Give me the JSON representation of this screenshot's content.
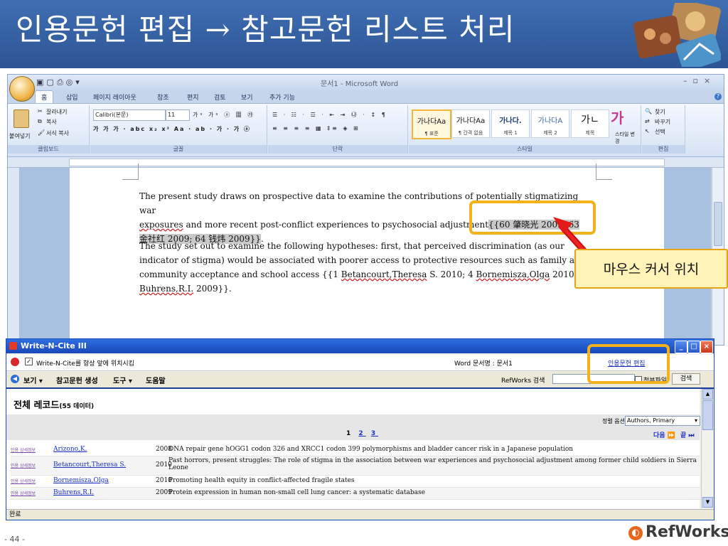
{
  "slide": {
    "title": "인용문헌 편집 → 참고문헌 리스트 처리",
    "page_number": "- 44 -",
    "brand": "RefWorks"
  },
  "word": {
    "window_title": "문서1 - Microsoft Word",
    "tabs": [
      "홈",
      "삽입",
      "페이지 레이아웃",
      "참조",
      "편지",
      "검토",
      "보기",
      "추가 기능"
    ],
    "ribbon": {
      "clipboard": {
        "label": "클립보드",
        "paste": "붙여넣기",
        "cut": "잘라내기",
        "copy": "복사",
        "format_painter": "서식 복사"
      },
      "font": {
        "label": "글꼴",
        "font_name": "Calibri(본문)",
        "font_size": "11"
      },
      "paragraph": {
        "label": "단락"
      },
      "styles": {
        "label": "스타일",
        "items": [
          {
            "sample": "가나다Aa",
            "caption": "¶ 표준"
          },
          {
            "sample": "가나다Aa",
            "caption": "¶ 간격 없음"
          },
          {
            "sample": "가나다.",
            "caption": "제목 1"
          },
          {
            "sample": "가나다A",
            "caption": "제목 2"
          },
          {
            "sample": "가ㄴ",
            "caption": "제목"
          }
        ],
        "change_styles": "스타일 변경"
      },
      "editing": {
        "label": "편집",
        "find": "찾기",
        "replace": "바꾸기",
        "select": "선택"
      }
    },
    "document": {
      "p1_a": "The present study draws on prospective data to examine the contributions of potentially stigmatizing war",
      "p1_b_sq": "exposures",
      "p1_b": "  and more recent post-conflict experiences to psychosocial adjustment",
      "p1_cite_a": "{{60 肇晓光 2009; 63",
      "p1_cite_b": "金社红 2009; 64 钱炜 2009}}",
      "p1_end": ".",
      "p2_a": " The study set out to examine the following hypotheses: first, that perceived discrimination (as our",
      "p2_b": "indicator of stigma) would be associated with poorer access to protective resources such as family and",
      "p2_c1": "community acceptance and school access {{1 ",
      "p2_c_link1": "Betancourt,Theresa",
      "p2_c2": " S. 2010; 4 ",
      "p2_c_link2": "Bornemisza,Olga",
      "p2_c3": " 2010; 5",
      "p2_d_link": "Buhrens,R.I.",
      "p2_d": " 2009}}."
    }
  },
  "wnc": {
    "title": "Write-N-Cite III",
    "stay_on_top": "Write-N-Cite를 항상 앞에 위치시킴",
    "word_doc_label": "Word 문서명 : 문서1",
    "edit_citation": "인용문헌 편집",
    "menu": {
      "view": "보기",
      "bibliography": "참고문헌 생성",
      "tools": "도구",
      "help": "도움말"
    },
    "search_label": "RefWorks 검색",
    "search_value": "",
    "attachment": "첨부파일",
    "search_button": "검색",
    "records_heading": "전체 레코드",
    "records_count": "(55 데이터)",
    "sort_label": "정렬 옵션",
    "sort_value": "Authors, Primary",
    "pages": [
      "1",
      "2",
      "3"
    ],
    "next": "다음",
    "end": "끝",
    "rows": [
      {
        "links": "인용 상세정보",
        "author": "Arizono,K.",
        "year": "2008",
        "title": "DNA repair gene hOGG1 codon 326 and XRCC1 codon 399 polymorphisms and bladder cancer risk in a Japanese population"
      },
      {
        "links": "인용 상세정보",
        "author": "Betancourt,Theresa S.",
        "year": "2010",
        "title": "Past horrors, present struggles: The role of stigma in the association between war experiences and psychosocial adjustment among former child soldiers in Sierra Leone"
      },
      {
        "links": "인용 상세정보",
        "author": "Bornemisza,Olga",
        "year": "2010",
        "title": "Promoting health equity in conflict-affected fragile states"
      },
      {
        "links": "인용 상세정보",
        "author": "Buhrens,R.I.",
        "year": "2009",
        "title": "Protein expression in human non-small cell lung cancer: a systematic database"
      }
    ],
    "status": "완료"
  },
  "callout": {
    "text": "마우스 커서 위치"
  },
  "colors": {
    "slide_header": "#3f6fb3",
    "highlight": "#f2b21c",
    "callout_bg": "#fff3b8",
    "wnc_title": "#1848b8",
    "pointer_arrow": "#e21a1a"
  }
}
